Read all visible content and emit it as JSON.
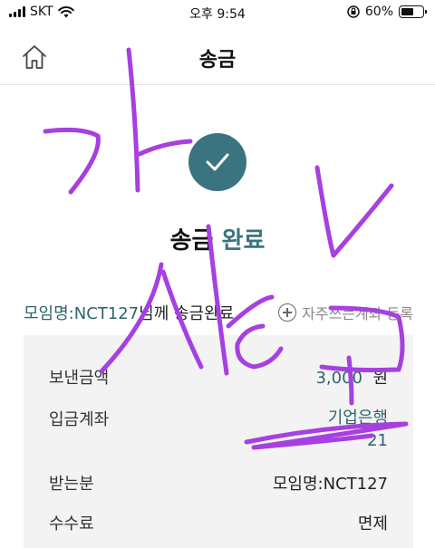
{
  "status_bar": {
    "carrier": "SKT",
    "time": "오후 9:54",
    "battery_percent": "60%",
    "battery_level": 0.6
  },
  "header": {
    "title": "송금",
    "home_icon": "home-icon"
  },
  "completion": {
    "icon": "check-icon",
    "title_part1": "송금",
    "title_part2": "완료",
    "accent_color": "#3a7480"
  },
  "recipient": {
    "name_prefix": "모임명:NCT127",
    "suffix": "님께 송금완료",
    "add_favorite_label": "자주쓰는계좌 등록"
  },
  "details": {
    "rows": [
      {
        "label": "보낸금액",
        "value": "3,000",
        "unit": "원"
      },
      {
        "label": "입금계좌",
        "bank": "기업은행",
        "account_tail": "21"
      },
      {
        "label": "받는분",
        "value": "모임명:NCT127"
      },
      {
        "label": "수수료",
        "value": "면제"
      }
    ]
  }
}
